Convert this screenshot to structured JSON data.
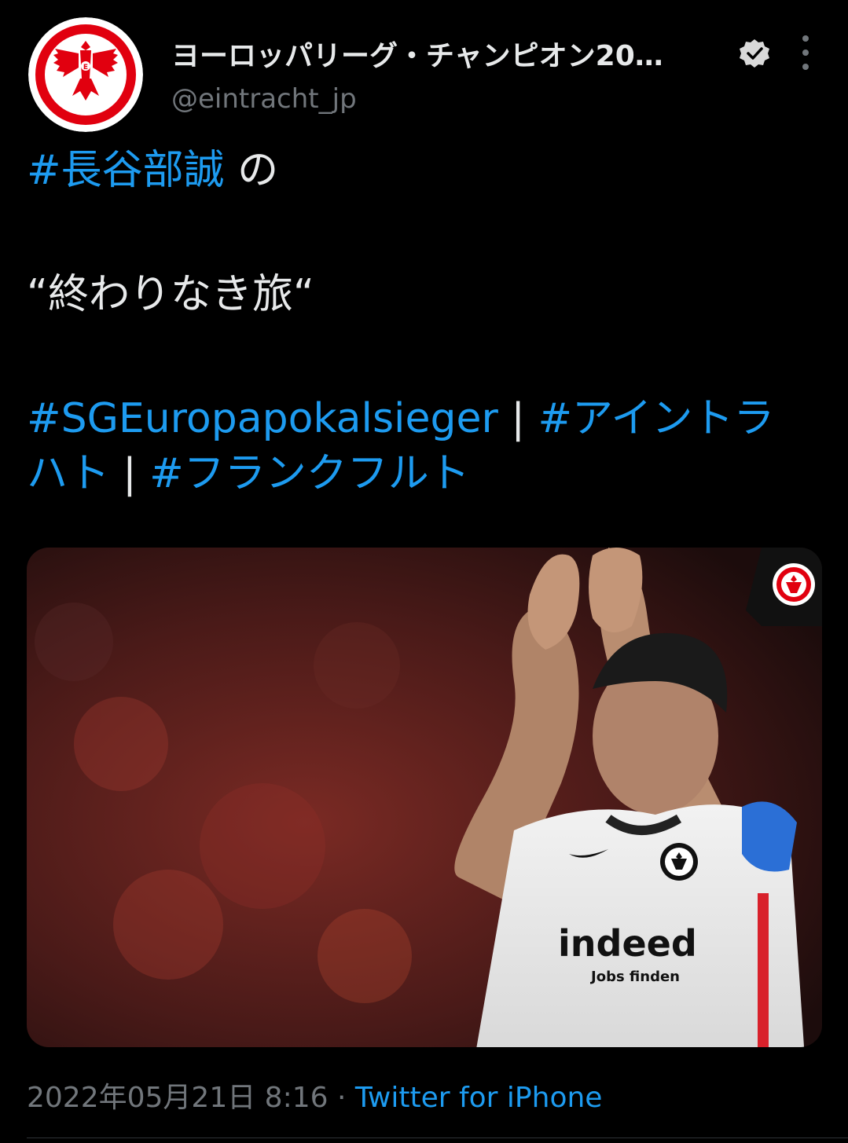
{
  "author": {
    "display_name": "ヨーロッパリーグ・チャンピオン20…",
    "handle": "@eintracht_jp",
    "avatar_icon": "eagle-crest-logo",
    "verified_icon": "verified-badge-icon"
  },
  "tweet": {
    "line1_hashtag": "#長谷部誠",
    "line1_rest": " の",
    "line2": "“終わりなき旅“",
    "line3_tag1": "#SGEuropapokalsieger",
    "line3_sep1": " | ",
    "line3_tag2a": "#アイントラ",
    "line4_tag2b": "ハト",
    "line4_sep2": " | ",
    "line4_tag3": "#フランクフルト"
  },
  "media": {
    "jersey_sponsor": "indeed",
    "jersey_sponsor_tagline": "Jobs finden"
  },
  "footer": {
    "timestamp": "2022年05月21日 8:16",
    "separator": " · ",
    "source": "Twitter for iPhone"
  },
  "colors": {
    "background": "#000000",
    "text": "#e7e9ea",
    "muted": "#71767b",
    "link": "#1d9bf0",
    "crest_red": "#e1000f"
  }
}
